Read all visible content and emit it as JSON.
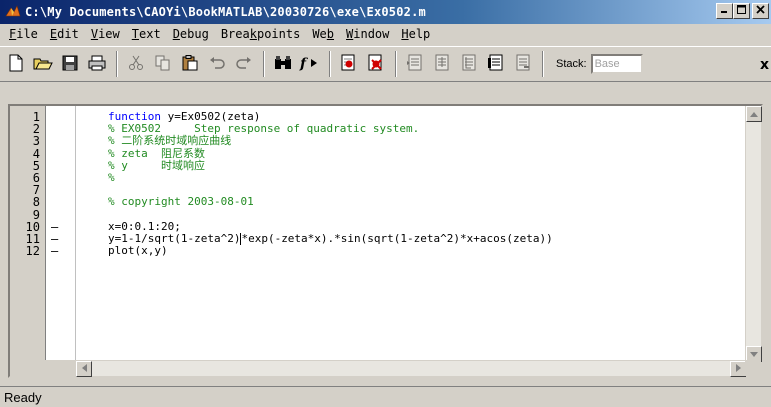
{
  "window": {
    "title": "C:\\My Documents\\CAOYi\\BookMATLAB\\20030726\\exe\\Ex0502.m",
    "buttons": [
      "_",
      "□",
      "x"
    ]
  },
  "menu": {
    "items": [
      {
        "label": "File",
        "underline": "F",
        "rest": "ile"
      },
      {
        "label": "Edit",
        "underline": "E",
        "rest": "dit"
      },
      {
        "label": "View",
        "underline": "V",
        "rest": "iew"
      },
      {
        "label": "Text",
        "underline": "T",
        "rest": "ext"
      },
      {
        "label": "Debug",
        "underline": "D",
        "rest": "ebug"
      },
      {
        "label": "Breakpoints",
        "pre": "Brea",
        "underline": "k",
        "rest": "points"
      },
      {
        "label": "Web",
        "pre": "We",
        "underline": "b",
        "rest": ""
      },
      {
        "label": "Window",
        "underline": "W",
        "rest": "indow"
      },
      {
        "label": "Help",
        "underline": "H",
        "rest": "elp"
      }
    ]
  },
  "toolbar": {
    "icons": [
      "new-file-icon",
      "open-folder-icon",
      "save-icon",
      "print-icon",
      "cut-icon",
      "copy-icon",
      "paste-icon",
      "undo-icon",
      "redo-icon",
      "find-icon",
      "function-icon",
      "set-breakpoint-icon",
      "clear-breakpoint-icon",
      "step-icon",
      "step-in-icon",
      "step-out-icon",
      "continue-icon",
      "exit-debug-icon"
    ],
    "stack_label": "Stack:",
    "stack_value": "Base",
    "close_label": "x"
  },
  "editor": {
    "lines": [
      {
        "num": "1",
        "bp": "",
        "code": "function y=Ex0502(zeta)",
        "kind": "code-kw"
      },
      {
        "num": "2",
        "bp": "",
        "code": "% EX0502     Step response of quadratic system.",
        "kind": "comment"
      },
      {
        "num": "3",
        "bp": "",
        "code": "% 二阶系统时域响应曲线",
        "kind": "comment"
      },
      {
        "num": "4",
        "bp": "",
        "code": "% zeta  阻尼系数",
        "kind": "comment"
      },
      {
        "num": "5",
        "bp": "",
        "code": "% y     时域响应",
        "kind": "comment"
      },
      {
        "num": "6",
        "bp": "",
        "code": "%",
        "kind": "comment"
      },
      {
        "num": "7",
        "bp": "",
        "code": "",
        "kind": "code"
      },
      {
        "num": "8",
        "bp": "",
        "code": "% copyright 2003-08-01",
        "kind": "comment"
      },
      {
        "num": "9",
        "bp": "",
        "code": "",
        "kind": "code"
      },
      {
        "num": "10",
        "bp": "–",
        "code": "x=0:0.1:20;",
        "kind": "code"
      },
      {
        "num": "11",
        "bp": "–",
        "code_before": "y=1-1/sqrt(1-zeta^2)",
        "code_after": "*exp(-zeta*x).*sin(sqrt(1-zeta^2)*x+acos(zeta))",
        "kind": "code-cursor"
      },
      {
        "num": "12",
        "bp": "–",
        "code": "plot(x,y)",
        "kind": "code"
      }
    ],
    "function_keyword": "function",
    "function_rest": " y=Ex0502(zeta)"
  },
  "status": {
    "text": "Ready"
  },
  "colors": {
    "titlebar_start": "#0a246a",
    "comment": "#228b22",
    "keyword": "#0000ff",
    "chrome": "#d4d0c8"
  }
}
